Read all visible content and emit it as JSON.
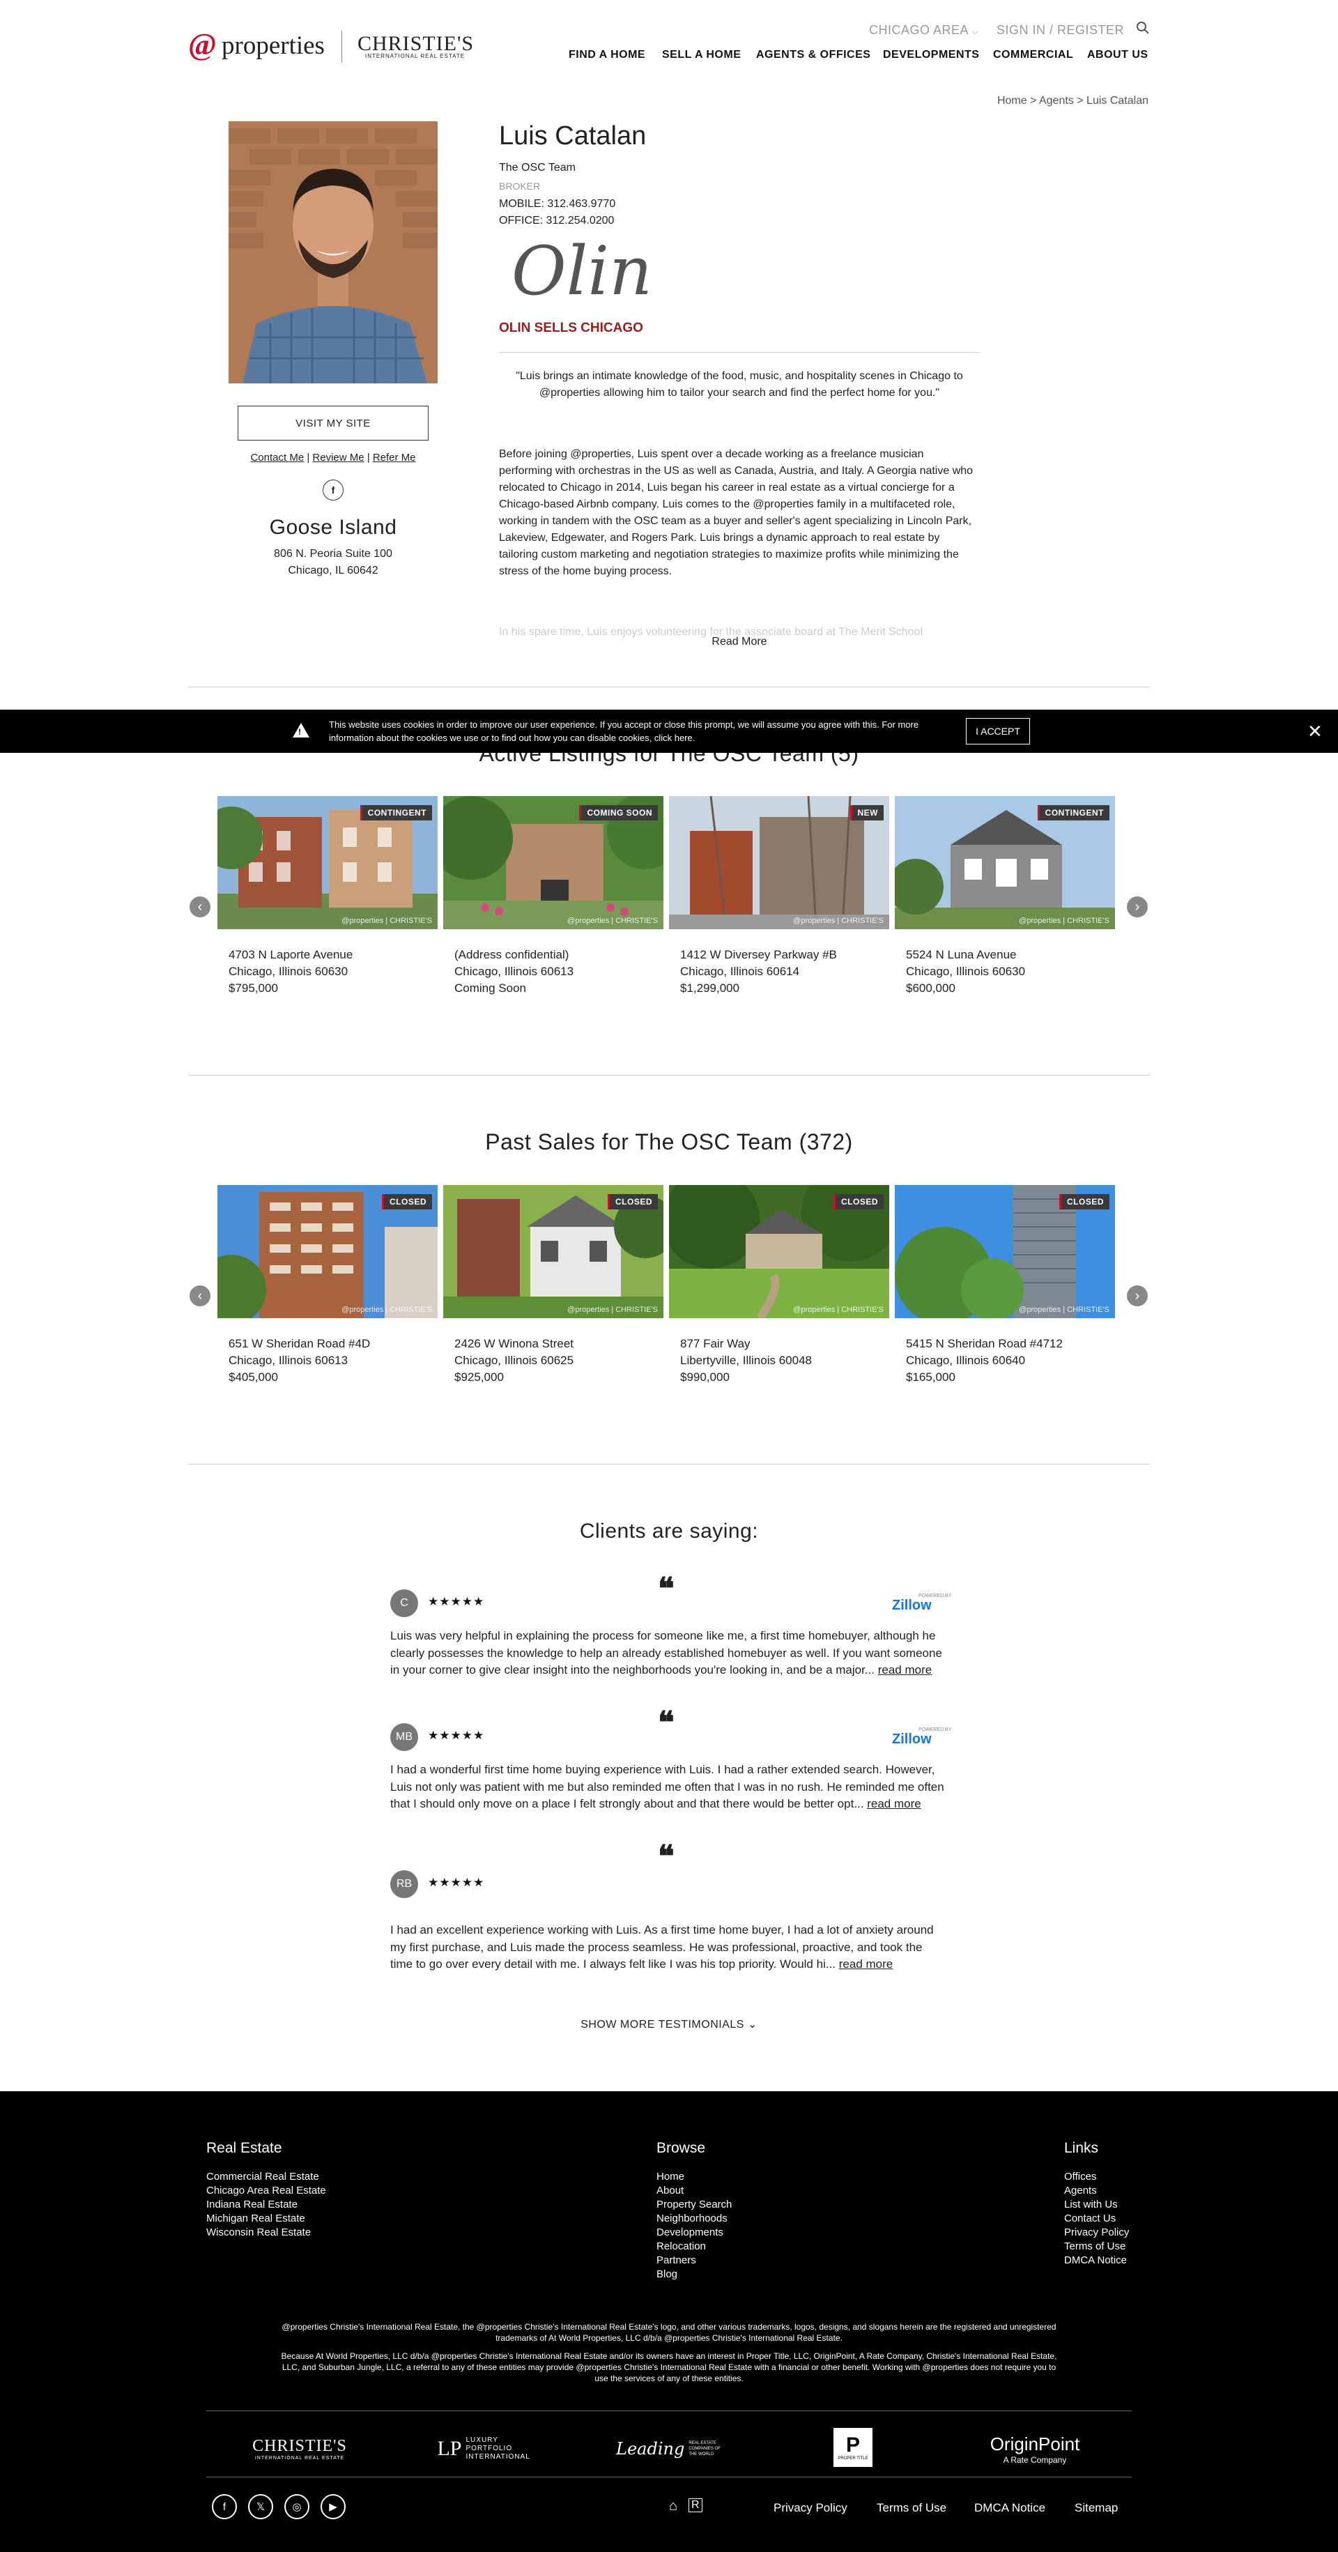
{
  "header": {
    "logo_at": "@",
    "logo_word": "properties",
    "logo_christies": "CHRISTIE'S",
    "logo_christies_sub": "INTERNATIONAL REAL ESTATE",
    "region": "CHICAGO AREA",
    "signin": "SIGN IN / REGISTER",
    "nav": [
      "FIND A HOME",
      "SELL A HOME",
      "AGENTS & OFFICES",
      "DEVELOPMENTS",
      "COMMERCIAL",
      "ABOUT US"
    ]
  },
  "breadcrumb": {
    "home": "Home",
    "sep": ">",
    "agents": "Agents",
    "current": "Luis Catalan"
  },
  "agent": {
    "name": "Luis Catalan",
    "team": "The OSC Team",
    "role": "BROKER",
    "mobile": "MOBILE: 312.463.9770",
    "office": "OFFICE: 312.254.0200",
    "signature": "Olin",
    "sells_tag": "OLIN SELLS CHICAGO",
    "visit_button": "VISIT MY SITE",
    "contact_links": [
      "Contact Me",
      "Review Me",
      "Refer Me"
    ],
    "facebook_icon": "f",
    "office_name": "Goose Island",
    "office_address1": "806 N. Peoria Suite 100",
    "office_address2": "Chicago, IL 60642",
    "quote": "\"Luis brings an intimate knowledge of the food, music, and hospitality scenes in Chicago to @properties allowing him to tailor your search and find the perfect home for you.\"",
    "bio": "Before joining @properties, Luis spent over a decade working as a freelance musician performing with orchestras in the US as well as Canada, Austria, and Italy. A Georgia native who relocated to Chicago in 2014, Luis began his career in real estate as a virtual concierge for a Chicago-based Airbnb company. Luis comes to the @properties family in a multifaceted role, working in tandem with the OSC team as a buyer and seller's agent specializing in Lincoln Park, Lakeview, Edgewater, and Rogers Park. Luis brings a dynamic approach to real estate by tailoring custom marketing and negotiation strategies to maximize profits while minimizing the stress of the home buying process.",
    "bio_fade": "In his spare time, Luis enjoys volunteering for the associate board at The Merit School",
    "read_more": "Read More"
  },
  "cookie": {
    "text": "This website uses cookies in order to improve our user experience. If you accept or close this prompt, we will assume you agree with this. For more information about the cookies we use or to find out how you can disable cookies, click here.",
    "accept": "I ACCEPT",
    "close": "✕",
    "warning_icon": "warning-icon"
  },
  "active": {
    "title": "Active Listings for The OSC Team (5)",
    "listings": [
      {
        "badge": "CONTINGENT",
        "address": "4703 N Laporte Avenue",
        "city": "Chicago, Illinois 60630",
        "price": "$795,000"
      },
      {
        "badge": "COMING SOON",
        "address": "(Address confidential)",
        "city": "Chicago, Illinois 60613",
        "price": "Coming Soon"
      },
      {
        "badge": "NEW",
        "address": "1412 W Diversey Parkway #B",
        "city": "Chicago, Illinois 60614",
        "price": "$1,299,000"
      },
      {
        "badge": "CONTINGENT",
        "address": "5524 N Luna Avenue",
        "city": "Chicago, Illinois 60630",
        "price": "$600,000"
      }
    ]
  },
  "past": {
    "title": "Past Sales for The OSC Team (372)",
    "listings": [
      {
        "badge": "CLOSED",
        "address": "651 W Sheridan Road #4D",
        "city": "Chicago, Illinois 60613",
        "price": "$405,000"
      },
      {
        "badge": "CLOSED",
        "address": "2426 W Winona Street",
        "city": "Chicago, Illinois 60625",
        "price": "$925,000"
      },
      {
        "badge": "CLOSED",
        "address": "877 Fair Way",
        "city": "Libertyville, Illinois 60048",
        "price": "$990,000"
      },
      {
        "badge": "CLOSED",
        "address": "5415 N Sheridan Road #4712",
        "city": "Chicago, Illinois 60640",
        "price": "$165,000"
      }
    ]
  },
  "watermark": "@properties | CHRISTIE'S",
  "carousel": {
    "prev": "‹",
    "next": "›"
  },
  "testimonials": {
    "title": "Clients are saying:",
    "quote_glyph": "❝",
    "zillow_label": "Zillow",
    "zillow_pre": "POWERED BY",
    "items": [
      {
        "initials": "C",
        "stars": "★★★★★",
        "rating": 5,
        "text": "Luis was very helpful in explaining the process for someone like me, a first time homebuyer, although he clearly possesses the knowledge to help an already established homebuyer as well. If you want someone in your corner to give clear insight into the neighborhoods you're looking in, and be a major...",
        "link": "read more"
      },
      {
        "initials": "MB",
        "stars": "★★★★★",
        "rating": 5,
        "text": "I had a wonderful first time home buying experience with Luis. I had a rather extended search. However, Luis not only was patient with me but also reminded me often that I was in no rush. He reminded me often that I should only move on a place I felt strongly about and that there would be better opt...",
        "link": "read more"
      },
      {
        "initials": "RB",
        "stars": "★★★★★",
        "rating": 5,
        "text": "I had an excellent experience working with Luis. As a first time home buyer, I had a lot of anxiety around my first purchase, and Luis made the process seamless. He was professional, proactive, and took the time to go over every detail with me. I always felt like I was his top priority. Would hi...",
        "link": "read more"
      }
    ],
    "show_more": "SHOW MORE TESTIMONIALS"
  },
  "footer": {
    "real_estate": {
      "heading": "Real Estate",
      "items": [
        "Commercial Real Estate",
        "Chicago Area Real Estate",
        "Indiana Real Estate",
        "Michigan Real Estate",
        "Wisconsin Real Estate"
      ]
    },
    "browse": {
      "heading": "Browse",
      "items": [
        "Home",
        "About",
        "Property Search",
        "Neighborhoods",
        "Developments",
        "Relocation",
        "Partners",
        "Blog"
      ]
    },
    "links": {
      "heading": "Links",
      "items": [
        "Offices",
        "Agents",
        "List with Us",
        "Contact Us",
        "Privacy Policy",
        "Terms of Use",
        "DMCA Notice"
      ]
    },
    "legal1": "@properties Christie's International Real Estate, the @properties Christie's International Real Estate's logo, and other various trademarks, logos, designs, and slogans herein are the registered and unregistered trademarks of At World Properties, LLC d/b/a @properties Christie's International Real Estate.",
    "legal2": "Because At World Properties, LLC d/b/a @properties Christie's International Real Estate and/or its owners have an interest in Proper Title, LLC, OriginPoint, A Rate Company, Christie's International Real Estate, LLC, and Suburban Jungle, LLC, a referral to any of these entities may provide @properties Christie's International Real Estate with a financial or other benefit. Working with @properties does not require you to use the services of any of these entities.",
    "partners": {
      "christies": "CHRISTIE'S",
      "christies_sub": "INTERNATIONAL REAL ESTATE",
      "lpi": "LUXURY PORTFOLIO INTERNATIONAL",
      "leading": "Leading",
      "leading_sub": "REAL ESTATE COMPANIES OF THE WORLD",
      "proper": "P",
      "proper_sub": "PROPER TITLE",
      "origin": "OriginPoint",
      "origin_sub": "A Rate Company"
    },
    "social": [
      "f",
      "𝕏",
      "◎",
      "▶"
    ],
    "equal_housing": "⌂",
    "bottom_links": [
      "Privacy Policy",
      "Terms of Use",
      "DMCA Notice",
      "Sitemap"
    ]
  }
}
